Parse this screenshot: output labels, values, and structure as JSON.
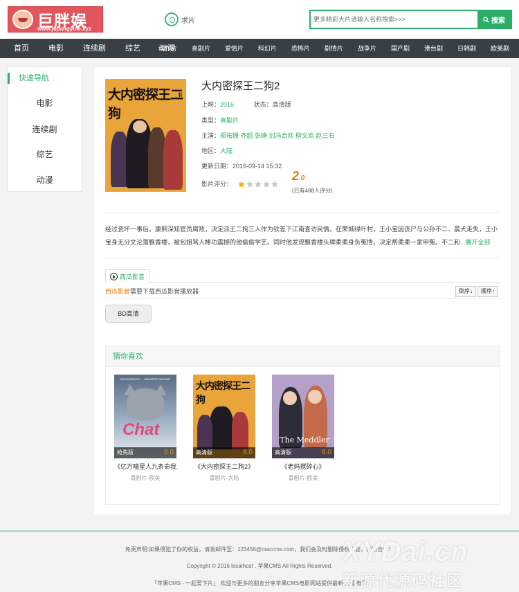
{
  "logo": {
    "title": "巨胖娱乐",
    "url": "www.jupangyule.xyz"
  },
  "header": {
    "request_label": "求片",
    "search_placeholder": "更多精彩大片请输入名称搜索>>>",
    "search_button": "搜索"
  },
  "nav": {
    "main": [
      "首页",
      "电影",
      "连续剧",
      "综艺",
      "动漫"
    ],
    "sub": [
      "动作片",
      "喜剧片",
      "爱情片",
      "科幻片",
      "恐怖片",
      "剧情片",
      "战争片",
      "国产剧",
      "港台剧",
      "日韩剧",
      "欧美剧"
    ]
  },
  "sidebar": {
    "title": "快速导航",
    "items": [
      "电影",
      "连续剧",
      "综艺",
      "动漫"
    ]
  },
  "movie": {
    "poster_title": "大内密探王二狗",
    "poster_suffix": "II",
    "title": "大内密探王二狗2",
    "release_label": "上映：",
    "release": "2016",
    "status_label": "状态：",
    "status": "高清版",
    "type_label": "类型：",
    "type": "喜剧片",
    "cast_label": "主演：",
    "cast": "郑拓珊 齐超 张峥 刘冯合欢 柳文欢 赵三石",
    "region_label": "地区：",
    "region": "大陆",
    "updated_label": "更新日期：",
    "updated": "2016-09-14 15:32",
    "rating_label": "影片评分：",
    "rating_stars": 1,
    "score": "2",
    "score_decimal": ".0",
    "votes": "(已有488人评分)",
    "description": "经过瓷坏一事后，康熙深知官员腐败，决定派王二狗三人作为钦差下江南查访民情。在荣城绿叶村，王小宝因丧尸与公孙不二、晨犬走失，王小宝身无分文沦落飘香楼，被包姐骂人棒功震撼的他偷偷学艺。同时他发现飘香楼头牌柔柔身负冤情，决定帮柔柔一家申冤。不二和",
    "expand_label": "...展开全部"
  },
  "player": {
    "tab": "西瓜影音",
    "notice_link": "西瓜影音",
    "notice_text": "需要下载西瓜影音播放器",
    "sort_desc": "倒序↓",
    "sort_asc": "顺序↑",
    "episode": "BD高清"
  },
  "recommend": {
    "title": "猜你喜欢",
    "items": [
      {
        "badge": "抢先版",
        "score": "8.0",
        "title": "《亿万喵星人九条命我",
        "meta": "喜剧片-欧美",
        "poster_top": "KEVIN SPACEY     JENNIFER GARNER",
        "poster_text": "Chat"
      },
      {
        "badge": "高清版",
        "score": "8.0",
        "title": "《大内密探王二狗2》",
        "meta": "喜剧片-大陆",
        "poster_text": "大内密探王二狗"
      },
      {
        "badge": "高清版",
        "score": "8.0",
        "title": "《老妈搅碎心》",
        "meta": "喜剧片-欧美",
        "poster_text": "The Meddler"
      }
    ]
  },
  "footer": {
    "line1": "免责声明:如果侵犯了你的权益，请发邮件至：123456@maccms.com，我们会及时删除侵权内容，谢谢合作！",
    "line2": "Copyright © 2016 localhost . 苹果CMS All Rights Reserved.",
    "line3": "「苹果CMS - 一起爱下片」 欢迎与更多的朋友分享苹果CMS电影网站提供最新-迅雷电影"
  },
  "watermark": {
    "line1": "XYDai.cn",
    "line2": "新源代源码社区"
  },
  "colors": {
    "accent": "#2bae6a",
    "nav_bg": "#3a3f44",
    "score": "#e87c0d",
    "logo_bg": "#e2555c"
  }
}
